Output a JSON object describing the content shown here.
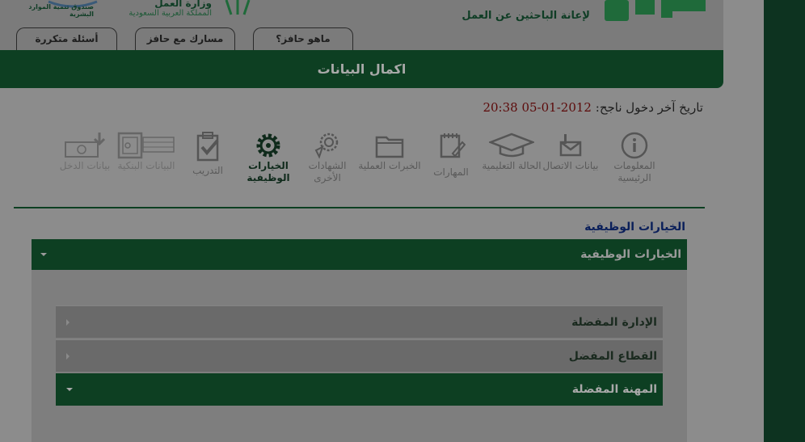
{
  "header": {
    "hafiz_tagline": "لإعانة الباحثين عن العمل",
    "ministry_name": "وزارة العمل",
    "ministry_country": "المملكة العربية السعودية",
    "fund_name": "صندوق تنمية الموارد البشرية"
  },
  "tabs": [
    {
      "label": "ماهو حافز؟"
    },
    {
      "label": "مسارك مع حافز"
    },
    {
      "label": "أسئلة متكررة"
    }
  ],
  "banner": {
    "title": "اكمال البيانات"
  },
  "last_login": {
    "label": "تاريخ آخر دخول ناجح:",
    "value": "2012-01-05 20:38"
  },
  "steps": [
    {
      "label": "المعلومات الرئيسية",
      "icon": "info-icon",
      "state": "normal"
    },
    {
      "label": "بيانات الاتصال",
      "icon": "mailbox-icon",
      "state": "normal"
    },
    {
      "label": "الحالة التعليمية",
      "icon": "graduation-cap-icon",
      "state": "normal"
    },
    {
      "label": "المهارات",
      "icon": "notepad-pencil-icon",
      "state": "normal"
    },
    {
      "label": "الخبرات العملية",
      "icon": "folder-icon",
      "state": "normal"
    },
    {
      "label": "الشهادات الأخرى",
      "icon": "award-ribbon-icon",
      "state": "normal"
    },
    {
      "label": "الخيارات الوظيفية",
      "icon": "gear-icon",
      "state": "active"
    },
    {
      "label": "التدريب",
      "icon": "clipboard-check-icon",
      "state": "normal"
    },
    {
      "label": "البيانات البنكية",
      "icon": "safe-icon",
      "state": "disabled"
    },
    {
      "label": "بيانات الدخل",
      "icon": "money-download-icon",
      "state": "disabled"
    }
  ],
  "section": {
    "title": "الخيارات الوظيفية"
  },
  "accordion": {
    "title": "الخيارات الوظيفية",
    "items": [
      {
        "title": "الإدارة المفضلة",
        "state": "collapsed"
      },
      {
        "title": "القطاع المفضل",
        "state": "collapsed"
      },
      {
        "title": "المهنة المفضلة",
        "state": "expanded"
      }
    ]
  },
  "colors": {
    "dark_green": "#0d3f22",
    "red_date": "#5c0a0a",
    "link_blue": "#0a1f5a"
  }
}
